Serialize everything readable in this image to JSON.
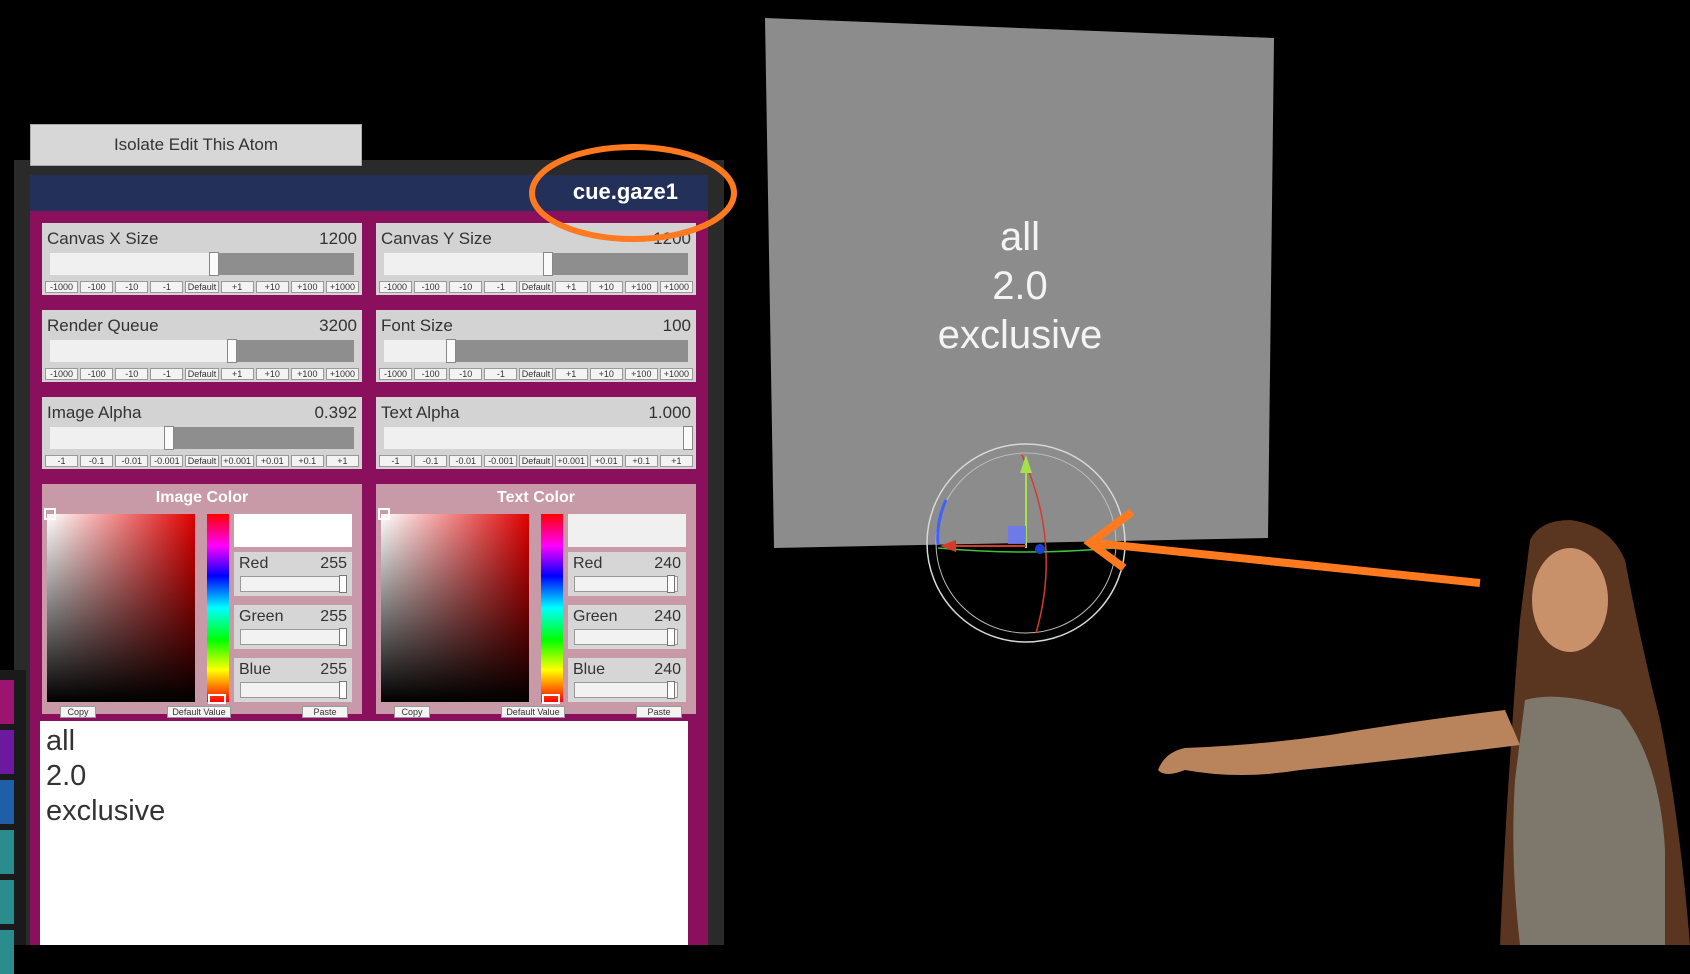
{
  "toolbar": {
    "isolate_label": "Isolate Edit This Atom"
  },
  "atom": {
    "name": "cue.gaze1"
  },
  "sliders": [
    {
      "label": "Canvas X Size",
      "value": "1200",
      "fraction": 0.54,
      "steps": [
        "-1000",
        "-100",
        "-10",
        "-1",
        "Default",
        "+1",
        "+10",
        "+100",
        "+1000"
      ]
    },
    {
      "label": "Canvas Y Size",
      "value": "1200",
      "fraction": 0.54,
      "steps": [
        "-1000",
        "-100",
        "-10",
        "-1",
        "Default",
        "+1",
        "+10",
        "+100",
        "+1000"
      ]
    },
    {
      "label": "Render Queue",
      "value": "3200",
      "fraction": 0.6,
      "steps": [
        "-1000",
        "-100",
        "-10",
        "-1",
        "Default",
        "+1",
        "+10",
        "+100",
        "+1000"
      ]
    },
    {
      "label": "Font Size",
      "value": "100",
      "fraction": 0.22,
      "steps": [
        "-1000",
        "-100",
        "-10",
        "-1",
        "Default",
        "+1",
        "+10",
        "+100",
        "+1000"
      ]
    },
    {
      "label": "Image Alpha",
      "value": "0.392",
      "fraction": 0.39,
      "steps": [
        "-1",
        "-0.1",
        "-0.01",
        "-0.001",
        "Default",
        "+0.001",
        "+0.01",
        "+0.1",
        "+1"
      ]
    },
    {
      "label": "Text Alpha",
      "value": "1.000",
      "fraction": 1.0,
      "steps": [
        "-1",
        "-0.1",
        "-0.01",
        "-0.001",
        "Default",
        "+0.001",
        "+0.01",
        "+0.1",
        "+1"
      ]
    }
  ],
  "colors": [
    {
      "title": "Image Color",
      "swatch": "#ffffff",
      "channels": [
        {
          "label": "Red",
          "value": "255"
        },
        {
          "label": "Green",
          "value": "255"
        },
        {
          "label": "Blue",
          "value": "255"
        }
      ],
      "buttons": {
        "copy": "Copy",
        "default": "Default Value",
        "paste": "Paste"
      }
    },
    {
      "title": "Text Color",
      "swatch": "#f0f0f0",
      "channels": [
        {
          "label": "Red",
          "value": "240"
        },
        {
          "label": "Green",
          "value": "240"
        },
        {
          "label": "Blue",
          "value": "240"
        }
      ],
      "buttons": {
        "copy": "Copy",
        "default": "Default Value",
        "paste": "Paste"
      }
    }
  ],
  "text": {
    "lines": [
      "all",
      "2.0",
      "exclusive"
    ]
  },
  "scene": {
    "quad_lines": [
      "all",
      "2.0",
      "exclusive"
    ]
  },
  "theme": {
    "panel": "#8a0f5c",
    "header": "#23315a",
    "annotation": "#ff7a1f",
    "quad": "#8c8c8c"
  }
}
